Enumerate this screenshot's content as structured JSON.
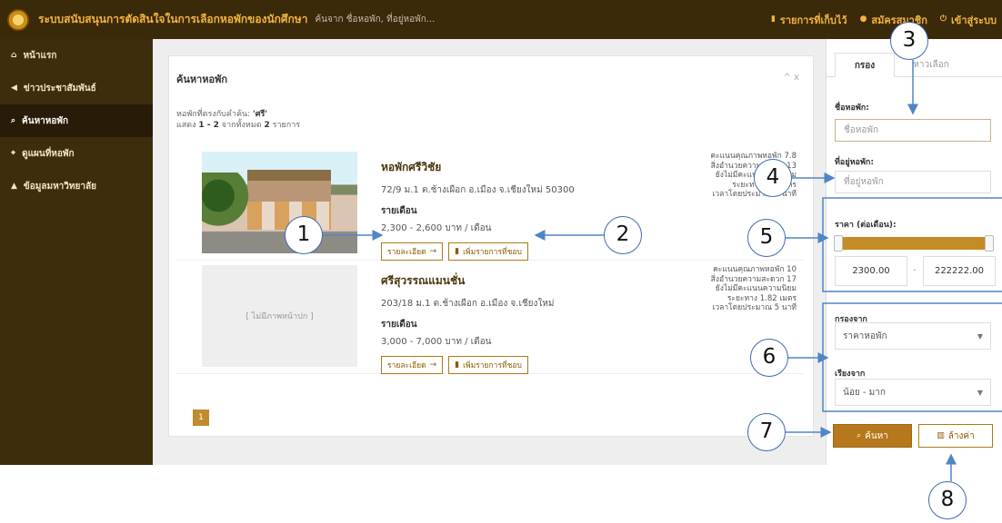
{
  "app": {
    "title": "ระบบสนับสนุนการตัดสินใจในการเลือกหอพักของนักศึกษา",
    "search_placeholder": "ค้นจาก ชื่อหอพัก, ที่อยู่หอพัก...",
    "saved_list": "รายการที่เก็บไว้",
    "register": "สมัครสมาชิก",
    "login": "เข้าสู่ระบบ"
  },
  "sidebar": {
    "items": [
      {
        "icon": "home-icon",
        "label": "หน้าแรก"
      },
      {
        "icon": "bullhorn-icon",
        "label": "ข่าวประชาสัมพันธ์"
      },
      {
        "icon": "search-icon",
        "label": "ค้นหาหอพัก"
      },
      {
        "icon": "map-marker-icon",
        "label": "ดูแผนที่หอพัก"
      },
      {
        "icon": "graduation-cap-icon",
        "label": "ข้อมูลมหาวิทยาลัย"
      }
    ]
  },
  "panel": {
    "title": "ค้นหาหอพัก",
    "tools": "^ x",
    "search_term_prefix": "หอพักที่ตรงกับคำค้น: ",
    "search_term": "'ศรี'",
    "show_prefix": "แสดง ",
    "show_range": "1 - 2",
    "show_middle": " จากทั้งหมด ",
    "show_total": "2",
    "show_suffix": " รายการ",
    "page": "1"
  },
  "results": [
    {
      "name": "หอพักศรีวิชัย",
      "address": "72/9 ม.1 ต.ช้างเผือก อ.เมือง จ.เชียงใหม่ 50300",
      "price_label": "รายเดือน",
      "price": "2,300 - 2,600 บาท / เดือน",
      "details": "รายละเอียด",
      "favorite": "เพิ่มรายการที่ชอบ",
      "metrics": [
        "คะแนนคุณภาพหอพัก 7.8",
        "สิ่งอำนวยความสะดวก 13",
        "ยังไม่มีคะแนนความนิยม",
        "ระยะทาง 0.5 เมตร",
        "เวลาโดยประมาณ 2 นาที"
      ],
      "image": "photo"
    },
    {
      "name": "ศรีสุวรรณแมนชั่น",
      "address": "203/18 ม.1 ต.ช้างเผือก อ.เมือง จ.เชียงใหม่",
      "price_label": "รายเดือน",
      "price": "3,000 - 7,000 บาท / เดือน",
      "details": "รายละเอียด",
      "favorite": "เพิ่มรายการที่ชอบ",
      "metrics": [
        "คะแนนคุณภาพหอพัก 10",
        "สิ่งอำนวยความสะดวก 17",
        "ยังไม่มีคะแนนความนิยม",
        "ระยะทาง 1.82 เมตร",
        "เวลาโดยประมาณ 5 นาที"
      ],
      "no_image": "[ ไม่มีภาพหน้าปก ]"
    }
  ],
  "filters": {
    "tab_active": "กรอง",
    "tab_inactive": "หาวเลือก",
    "dorm_name_label": "ชื่อหอพัก:",
    "dorm_name_placeholder": "ชื่อหอพัก",
    "dorm_address_label": "ที่อยู่หอพัก:",
    "dorm_address_placeholder": "ที่อยู่หอพัก",
    "price_label": "ราคา (ต่อเดือน):",
    "min_price": "2300.00",
    "max_price": "222222.00",
    "range_separator": "-",
    "filter_by_label": "กรองจาก",
    "filter_by_value": "ราคาหอพัก",
    "sort_by_label": "เรียงจาก",
    "sort_by_value": "น้อย - มาก",
    "search_button": "ค้นหา",
    "clear_button": "ล้างค่า"
  },
  "callouts": [
    "1",
    "2",
    "3",
    "4",
    "5",
    "6",
    "7",
    "8"
  ],
  "colors": {
    "topbar": "#3a2a0a",
    "gold": "#f3b33d",
    "button": "#b6781b",
    "callout_blue": "#4f86c6"
  }
}
